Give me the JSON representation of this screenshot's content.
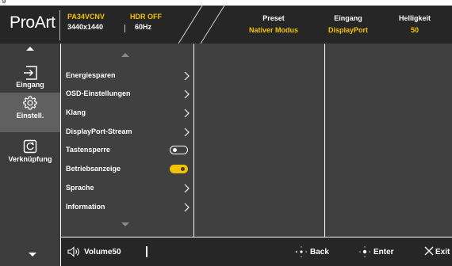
{
  "top_strip_text": "g",
  "header": {
    "logo": "ProArt",
    "model": "PA34VCNV",
    "resolution": "3440x1440",
    "hdr": "HDR OFF",
    "refresh": "60Hz",
    "columns": [
      {
        "label": "Preset",
        "value": "Nativer Modus"
      },
      {
        "label": "Eingang",
        "value": "DisplayPort"
      },
      {
        "label": "Helligkeit",
        "value": "50"
      }
    ]
  },
  "sidebar": {
    "items": [
      {
        "label": "Eingang",
        "icon": "input-icon",
        "active": false
      },
      {
        "label": "Einstell.",
        "icon": "gear-icon",
        "active": true
      },
      {
        "label": "Verknüpfung",
        "icon": "shortcut-icon",
        "active": false
      }
    ]
  },
  "menu": {
    "items": [
      {
        "label": "Energiesparen",
        "control": "chevron"
      },
      {
        "label": "OSD-Einstellungen",
        "control": "chevron"
      },
      {
        "label": "Klang",
        "control": "chevron"
      },
      {
        "label": "DisplayPort-Stream",
        "control": "chevron"
      },
      {
        "label": "Tastensperre",
        "control": "toggle",
        "state": "off"
      },
      {
        "label": "Betriebsanzeige",
        "control": "toggle",
        "state": "on"
      },
      {
        "label": "Sprache",
        "control": "chevron"
      },
      {
        "label": "Information",
        "control": "chevron"
      }
    ]
  },
  "footer": {
    "volume_label": "Volume50",
    "back_label": "Back",
    "enter_label": "Enter",
    "exit_label": "Exit"
  },
  "colors": {
    "accent": "#f2c200",
    "header_bg": "#262626",
    "panel_bg": "#404040",
    "sidebar_bg": "#3c3c3c",
    "active_bg": "#606060"
  }
}
